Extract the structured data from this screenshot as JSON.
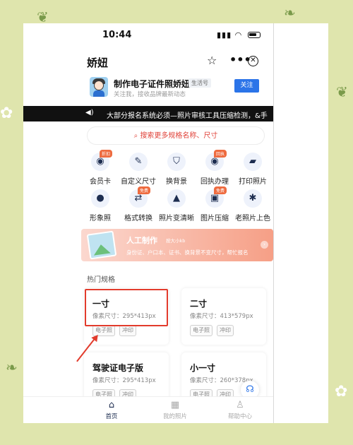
{
  "status_bar": {
    "time": "10:44",
    "signal_icon": "signal-icon",
    "wifi_icon": "wifi-icon",
    "battery_icon": "battery-icon"
  },
  "nav": {
    "title": "娇妞",
    "star_icon": "star-icon",
    "more_icon": "more-icon",
    "close_icon": "close-icon"
  },
  "account": {
    "name": "制作电子证件照娇妞",
    "tag": "生活号",
    "subtitle": "关注我，接收品牌最新动态",
    "follow_label": "关注"
  },
  "notice": {
    "speaker_icon": "speaker-icon",
    "text": "大部分报名系统必须—照片审核工具压缩检测，&手"
  },
  "search": {
    "placeholder": "搜索更多规格名称、尺寸",
    "icon": "search-icon"
  },
  "features": [
    {
      "label": "会员卡",
      "icon": "camera-icon",
      "badge": "折扣"
    },
    {
      "label": "自定义尺寸",
      "icon": "pencil-icon",
      "badge": ""
    },
    {
      "label": "换背景",
      "icon": "shield-icon",
      "badge": ""
    },
    {
      "label": "回执办理",
      "icon": "camera-icon",
      "badge": "回执"
    },
    {
      "label": "打印照片",
      "icon": "ruler-icon",
      "badge": ""
    },
    {
      "label": "形象照",
      "icon": "person-icon",
      "badge": ""
    },
    {
      "label": "格式转换",
      "icon": "convert-icon",
      "badge": "免费"
    },
    {
      "label": "照片变清晰",
      "icon": "image-icon",
      "badge": ""
    },
    {
      "label": "图片压缩",
      "icon": "compress-icon",
      "badge": "免费"
    },
    {
      "label": "老照片上色",
      "icon": "palette-icon",
      "badge": ""
    }
  ],
  "banner": {
    "title": "人工制作",
    "title_suffix": "按大小kb",
    "subtitle": "身份证、户口本、证书、换背景不变尺寸，帮忙报名"
  },
  "section_title": "热门规格",
  "cards": [
    {
      "title": "一寸",
      "size": "像素尺寸：295*413px",
      "tags": [
        "电子照",
        "冲印"
      ]
    },
    {
      "title": "二寸",
      "size": "像素尺寸：413*579px",
      "tags": [
        "电子照",
        "冲印"
      ]
    },
    {
      "title": "驾驶证电子版",
      "size": "像素尺寸：295*413px",
      "tags": [
        "电子照",
        "冲印"
      ]
    },
    {
      "title": "小一寸",
      "size": "像素尺寸：260*378px",
      "tags": [
        "电子照",
        "冲印"
      ]
    }
  ],
  "tabbar": [
    {
      "label": "首页",
      "icon": "home-icon",
      "active": true
    },
    {
      "label": "我的照片",
      "icon": "grid-icon",
      "active": false
    },
    {
      "label": "帮助中心",
      "icon": "user-icon",
      "active": false
    }
  ],
  "colors": {
    "accent": "#2b74e8",
    "highlight": "#e23b2c",
    "search_text": "#e0433a",
    "background": "#dfe5ad"
  }
}
